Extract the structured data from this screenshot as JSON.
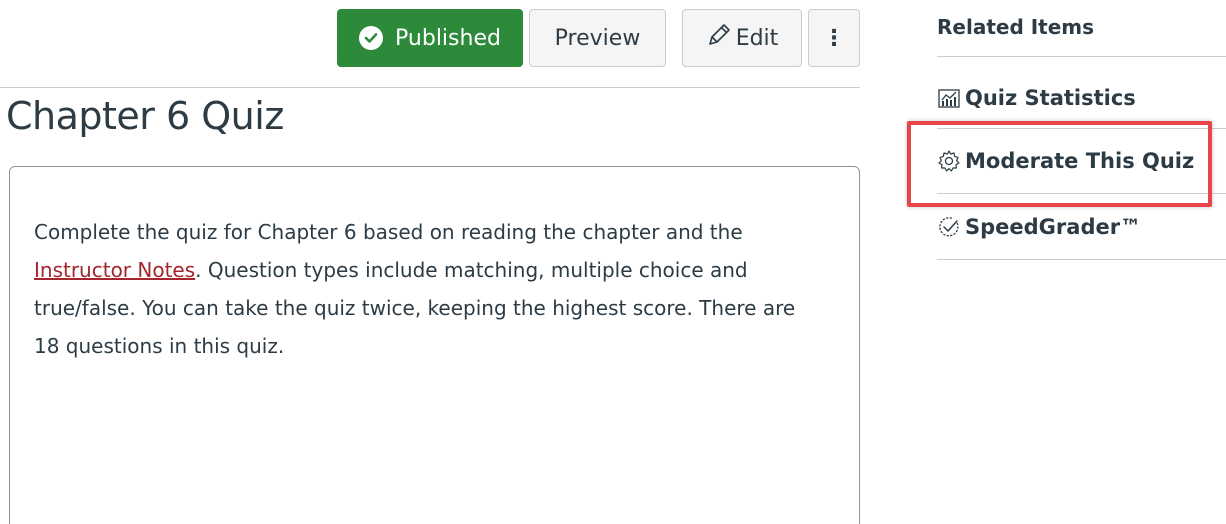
{
  "toolbar": {
    "published_label": "Published",
    "preview_label": "Preview",
    "edit_label": "Edit",
    "more_label": "⋮"
  },
  "quiz": {
    "title": "Chapter 6 Quiz",
    "description_before_link": "Complete the quiz for Chapter 6 based on reading the chapter and the ",
    "description_link": "Instructor Notes",
    "description_after_link": ". Question types include matching, multiple choice and true/false. You can take the quiz twice, keeping the highest score. There are 18 questions in this quiz."
  },
  "sidebar": {
    "heading": "Related Items",
    "items": [
      {
        "label": "Quiz Statistics",
        "icon": "stats-icon"
      },
      {
        "label": "Moderate This Quiz",
        "icon": "gear-icon"
      },
      {
        "label": "SpeedGrader™",
        "icon": "speedgrader-icon"
      }
    ]
  },
  "colors": {
    "published_green": "#2c8a3a",
    "link_red": "#a4262c",
    "highlight_red": "#e8444a",
    "text": "#2d3b45"
  }
}
